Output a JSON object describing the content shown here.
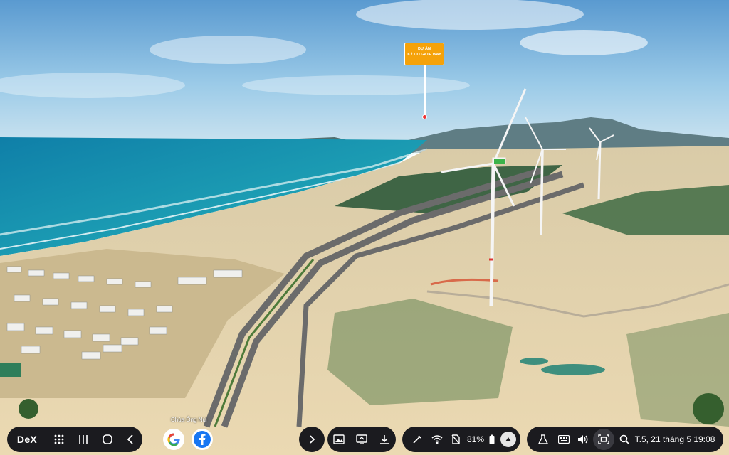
{
  "pin": {
    "line1": "DỰ ÁN",
    "line2": "KỲ CO GATE WAY"
  },
  "map_label": "Chùa Ông Núi",
  "taskbar": {
    "dex_label": "DeX",
    "battery_percent": "81%",
    "clock": "T.5, 21 tháng 5 19:08",
    "icons": [
      "apps-grid-icon",
      "recents-icon",
      "home-icon",
      "back-icon",
      "google-icon",
      "facebook-icon",
      "chevron-right-icon",
      "gallery-icon",
      "screen-mirror-icon",
      "download-icon",
      "pen-icon",
      "wifi-icon",
      "no-sim-icon",
      "battery-icon",
      "caret-up-icon",
      "flask-icon",
      "keyboard-icon",
      "volume-icon",
      "screenshot-icon",
      "search-icon"
    ]
  },
  "colors": {
    "taskbar_bg": "#1b1b1f",
    "pin_bg": "#f5a20a",
    "accent_orange": "#c8901a"
  }
}
